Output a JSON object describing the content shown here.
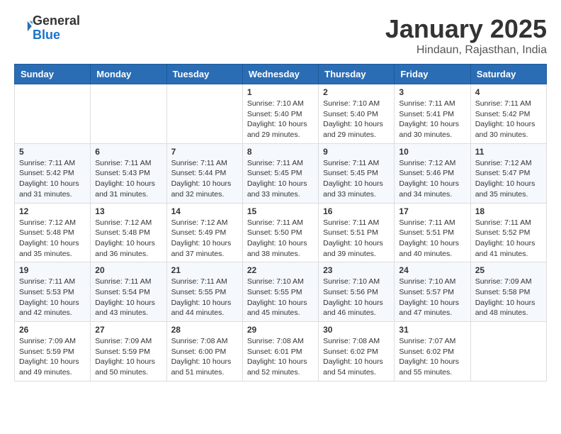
{
  "header": {
    "logo_general": "General",
    "logo_blue": "Blue",
    "month_title": "January 2025",
    "location": "Hindaun, Rajasthan, India"
  },
  "days_of_week": [
    "Sunday",
    "Monday",
    "Tuesday",
    "Wednesday",
    "Thursday",
    "Friday",
    "Saturday"
  ],
  "weeks": [
    [
      {
        "day": "",
        "info": ""
      },
      {
        "day": "",
        "info": ""
      },
      {
        "day": "",
        "info": ""
      },
      {
        "day": "1",
        "info": "Sunrise: 7:10 AM\nSunset: 5:40 PM\nDaylight: 10 hours and 29 minutes."
      },
      {
        "day": "2",
        "info": "Sunrise: 7:10 AM\nSunset: 5:40 PM\nDaylight: 10 hours and 29 minutes."
      },
      {
        "day": "3",
        "info": "Sunrise: 7:11 AM\nSunset: 5:41 PM\nDaylight: 10 hours and 30 minutes."
      },
      {
        "day": "4",
        "info": "Sunrise: 7:11 AM\nSunset: 5:42 PM\nDaylight: 10 hours and 30 minutes."
      }
    ],
    [
      {
        "day": "5",
        "info": "Sunrise: 7:11 AM\nSunset: 5:42 PM\nDaylight: 10 hours and 31 minutes."
      },
      {
        "day": "6",
        "info": "Sunrise: 7:11 AM\nSunset: 5:43 PM\nDaylight: 10 hours and 31 minutes."
      },
      {
        "day": "7",
        "info": "Sunrise: 7:11 AM\nSunset: 5:44 PM\nDaylight: 10 hours and 32 minutes."
      },
      {
        "day": "8",
        "info": "Sunrise: 7:11 AM\nSunset: 5:45 PM\nDaylight: 10 hours and 33 minutes."
      },
      {
        "day": "9",
        "info": "Sunrise: 7:11 AM\nSunset: 5:45 PM\nDaylight: 10 hours and 33 minutes."
      },
      {
        "day": "10",
        "info": "Sunrise: 7:12 AM\nSunset: 5:46 PM\nDaylight: 10 hours and 34 minutes."
      },
      {
        "day": "11",
        "info": "Sunrise: 7:12 AM\nSunset: 5:47 PM\nDaylight: 10 hours and 35 minutes."
      }
    ],
    [
      {
        "day": "12",
        "info": "Sunrise: 7:12 AM\nSunset: 5:48 PM\nDaylight: 10 hours and 35 minutes."
      },
      {
        "day": "13",
        "info": "Sunrise: 7:12 AM\nSunset: 5:48 PM\nDaylight: 10 hours and 36 minutes."
      },
      {
        "day": "14",
        "info": "Sunrise: 7:12 AM\nSunset: 5:49 PM\nDaylight: 10 hours and 37 minutes."
      },
      {
        "day": "15",
        "info": "Sunrise: 7:11 AM\nSunset: 5:50 PM\nDaylight: 10 hours and 38 minutes."
      },
      {
        "day": "16",
        "info": "Sunrise: 7:11 AM\nSunset: 5:51 PM\nDaylight: 10 hours and 39 minutes."
      },
      {
        "day": "17",
        "info": "Sunrise: 7:11 AM\nSunset: 5:51 PM\nDaylight: 10 hours and 40 minutes."
      },
      {
        "day": "18",
        "info": "Sunrise: 7:11 AM\nSunset: 5:52 PM\nDaylight: 10 hours and 41 minutes."
      }
    ],
    [
      {
        "day": "19",
        "info": "Sunrise: 7:11 AM\nSunset: 5:53 PM\nDaylight: 10 hours and 42 minutes."
      },
      {
        "day": "20",
        "info": "Sunrise: 7:11 AM\nSunset: 5:54 PM\nDaylight: 10 hours and 43 minutes."
      },
      {
        "day": "21",
        "info": "Sunrise: 7:11 AM\nSunset: 5:55 PM\nDaylight: 10 hours and 44 minutes."
      },
      {
        "day": "22",
        "info": "Sunrise: 7:10 AM\nSunset: 5:55 PM\nDaylight: 10 hours and 45 minutes."
      },
      {
        "day": "23",
        "info": "Sunrise: 7:10 AM\nSunset: 5:56 PM\nDaylight: 10 hours and 46 minutes."
      },
      {
        "day": "24",
        "info": "Sunrise: 7:10 AM\nSunset: 5:57 PM\nDaylight: 10 hours and 47 minutes."
      },
      {
        "day": "25",
        "info": "Sunrise: 7:09 AM\nSunset: 5:58 PM\nDaylight: 10 hours and 48 minutes."
      }
    ],
    [
      {
        "day": "26",
        "info": "Sunrise: 7:09 AM\nSunset: 5:59 PM\nDaylight: 10 hours and 49 minutes."
      },
      {
        "day": "27",
        "info": "Sunrise: 7:09 AM\nSunset: 5:59 PM\nDaylight: 10 hours and 50 minutes."
      },
      {
        "day": "28",
        "info": "Sunrise: 7:08 AM\nSunset: 6:00 PM\nDaylight: 10 hours and 51 minutes."
      },
      {
        "day": "29",
        "info": "Sunrise: 7:08 AM\nSunset: 6:01 PM\nDaylight: 10 hours and 52 minutes."
      },
      {
        "day": "30",
        "info": "Sunrise: 7:08 AM\nSunset: 6:02 PM\nDaylight: 10 hours and 54 minutes."
      },
      {
        "day": "31",
        "info": "Sunrise: 7:07 AM\nSunset: 6:02 PM\nDaylight: 10 hours and 55 minutes."
      },
      {
        "day": "",
        "info": ""
      }
    ]
  ]
}
